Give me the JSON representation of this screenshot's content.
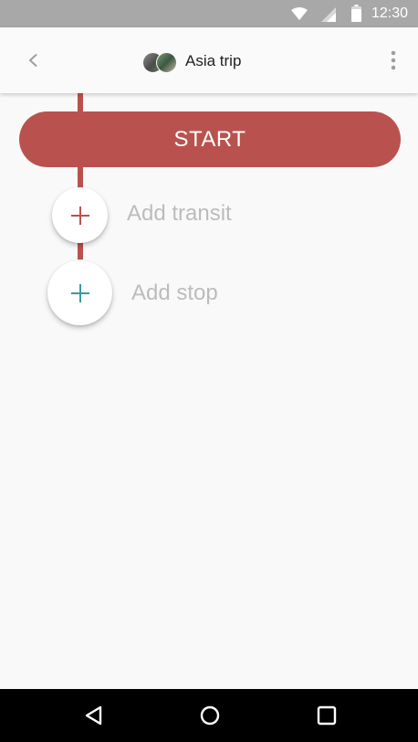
{
  "status_bar": {
    "time": "12:30",
    "icons": [
      "wifi-icon",
      "cell-signal-icon",
      "battery-icon"
    ]
  },
  "app_bar": {
    "title": "Asia trip",
    "back_icon": "chevron-left-icon",
    "menu_icon": "more-vertical-icon",
    "avatars": [
      "avatar-1",
      "avatar-2"
    ]
  },
  "timeline": {
    "start_label": "START",
    "items": [
      {
        "label": "Add transit",
        "icon": "plus-icon"
      },
      {
        "label": "Add stop",
        "icon": "plus-icon"
      }
    ]
  },
  "nav_bar": {
    "buttons": [
      "back-triangle-icon",
      "home-circle-icon",
      "recents-square-icon"
    ]
  },
  "colors": {
    "status_bar": "#a8a8a8",
    "accent_red": "#b9524e",
    "accent_teal": "#3a9a9e",
    "hint_text": "#bcbcbc",
    "background": "#f9f9f9"
  }
}
